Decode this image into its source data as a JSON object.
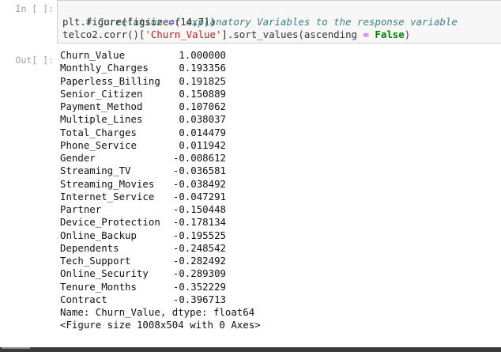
{
  "input_prompt": "In [ ]:",
  "output_prompt": "Out[ ]:",
  "code": {
    "comment": "# Correlation of explanatory Variables to the response variable",
    "line2": {
      "a": "plt.figure(figsize",
      "eq": "=",
      "b": "(14,7))"
    },
    "line3": {
      "a": "telco2.corr()[",
      "str": "'Churn_Value'",
      "b": "].sort_values(ascending ",
      "eq": "=",
      "sp": " ",
      "kw": "False",
      "c": ")"
    }
  },
  "series": [
    {
      "name": "Churn_Value",
      "value": "1.000000"
    },
    {
      "name": "Monthly_Charges",
      "value": "0.193356"
    },
    {
      "name": "Paperless_Billing",
      "value": "0.191825"
    },
    {
      "name": "Senior_Citizen",
      "value": "0.150889"
    },
    {
      "name": "Payment_Method",
      "value": "0.107062"
    },
    {
      "name": "Multiple_Lines",
      "value": "0.038037"
    },
    {
      "name": "Total_Charges",
      "value": "0.014479"
    },
    {
      "name": "Phone_Service",
      "value": "0.011942"
    },
    {
      "name": "Gender",
      "value": "-0.008612"
    },
    {
      "name": "Streaming_TV",
      "value": "-0.036581"
    },
    {
      "name": "Streaming_Movies",
      "value": "-0.038492"
    },
    {
      "name": "Internet_Service",
      "value": "-0.047291"
    },
    {
      "name": "Partner",
      "value": "-0.150448"
    },
    {
      "name": "Device_Protection",
      "value": "-0.178134"
    },
    {
      "name": "Online_Backup",
      "value": "-0.195525"
    },
    {
      "name": "Dependents",
      "value": "-0.248542"
    },
    {
      "name": "Tech_Support",
      "value": "-0.282492"
    },
    {
      "name": "Online_Security",
      "value": "-0.289309"
    },
    {
      "name": "Tenure_Months",
      "value": "-0.352229"
    },
    {
      "name": "Contract",
      "value": "-0.396713"
    }
  ],
  "footer_line": "Name: Churn_Value, dtype: float64",
  "figure_line": "<Figure size 1008x504 with 0 Axes>"
}
